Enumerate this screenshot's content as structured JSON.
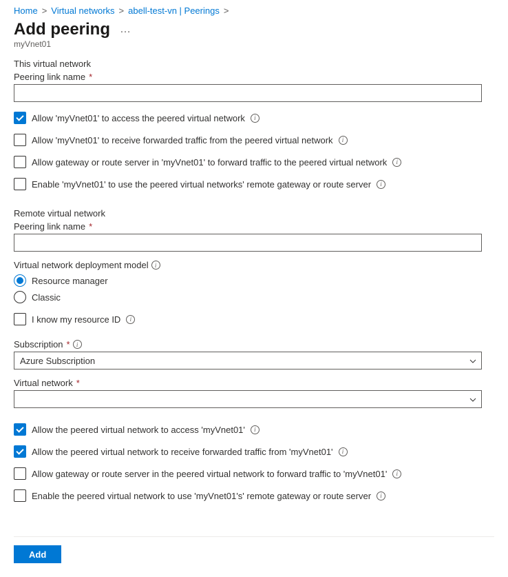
{
  "breadcrumb": {
    "home": "Home",
    "vnets": "Virtual networks",
    "vnet": "abell-test-vn | Peerings"
  },
  "header": {
    "title": "Add peering",
    "subtitle": "myVnet01"
  },
  "local": {
    "section_title": "This virtual network",
    "peering_link_label": "Peering link name",
    "peering_link_value": "",
    "cb_access": "Allow 'myVnet01' to access the peered virtual network",
    "cb_receive_fwd": "Allow 'myVnet01' to receive forwarded traffic from the peered virtual network",
    "cb_gateway_fwd": "Allow gateway or route server in 'myVnet01' to forward traffic to the peered virtual network",
    "cb_use_remote_gw": "Enable 'myVnet01' to use the peered virtual networks' remote gateway or route server"
  },
  "remote": {
    "section_title": "Remote virtual network",
    "peering_link_label": "Peering link name",
    "peering_link_value": "",
    "deployment_model_label": "Virtual network deployment model",
    "radio_rm": "Resource manager",
    "radio_classic": "Classic",
    "cb_know_resource_id": "I know my resource ID",
    "subscription_label": "Subscription",
    "subscription_value": "Azure Subscription",
    "vnet_label": "Virtual network",
    "vnet_value": "",
    "cb_access": "Allow the peered virtual network to access 'myVnet01'",
    "cb_receive_fwd": "Allow the peered virtual network to receive forwarded traffic from 'myVnet01'",
    "cb_gateway_fwd": "Allow gateway or route server in the peered virtual network to forward traffic to 'myVnet01'",
    "cb_use_remote_gw": "Enable the peered virtual network to use 'myVnet01's' remote gateway or route server"
  },
  "footer": {
    "add_button": "Add"
  }
}
